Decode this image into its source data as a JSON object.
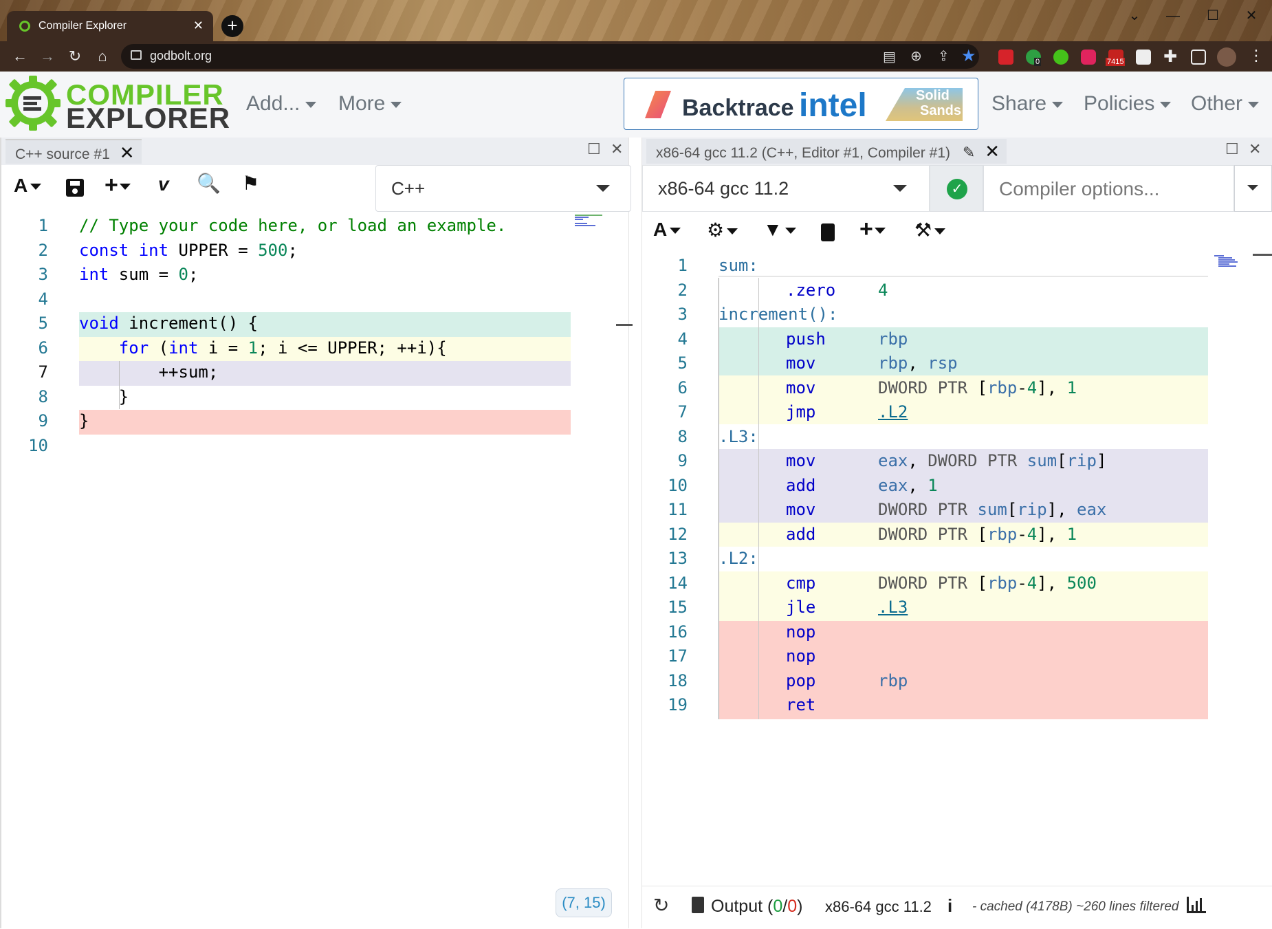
{
  "browser": {
    "tab_title": "Compiler Explorer",
    "url": "godbolt.org",
    "badge_count": "7415",
    "badge_zero": "0"
  },
  "header": {
    "logo_line1": "COMPILER",
    "logo_line2": "EXPLORER",
    "menus": {
      "add": "Add...",
      "more": "More",
      "share": "Share",
      "policies": "Policies",
      "other": "Other"
    },
    "sponsors": {
      "backtrace": "Backtrace",
      "intel": "intel",
      "solid_sands_1": "Solid",
      "solid_sands_2": "Sands"
    }
  },
  "source_pane": {
    "tab_label": "C++ source #1",
    "language": "C++",
    "cursor_position": "(7, 15)",
    "lines": [
      "// Type your code here, or load an example.",
      "const int UPPER = 500;",
      "int sum = 0;",
      "",
      "void increment() {",
      "    for (int i = 1; i <= UPPER; ++i){",
      "        ++sum;",
      "    }",
      "}",
      ""
    ]
  },
  "compiler_pane": {
    "tab_label": "x86-64 gcc 11.2 (C++, Editor #1, Compiler #1)",
    "compiler": "x86-64 gcc 11.2",
    "options_placeholder": "Compiler options...",
    "status": {
      "output_label": "Output (",
      "output_ok": "0",
      "output_sep": "/",
      "output_err": "0",
      "output_close": ")",
      "compiler": "x86-64 gcc 11.2",
      "info": "- cached (4178B) ~260 lines filtered"
    },
    "asm": [
      "sum:",
      ".zero   4",
      "increment():",
      "push    rbp",
      "mov     rbp, rsp",
      "mov     DWORD PTR [rbp-4], 1",
      "jmp     .L2",
      ".L3:",
      "mov     eax, DWORD PTR sum[rip]",
      "add     eax, 1",
      "mov     DWORD PTR sum[rip], eax",
      "add     DWORD PTR [rbp-4], 1",
      ".L2:",
      "cmp     DWORD PTR [rbp-4], 500",
      "jle     .L3",
      "nop",
      "nop",
      "pop     rbp",
      "ret"
    ]
  },
  "colors": {
    "green": "#d6f0e8",
    "yellow": "#fdfde4",
    "purple": "#e5e3f0",
    "red": "#fdd0cb"
  }
}
